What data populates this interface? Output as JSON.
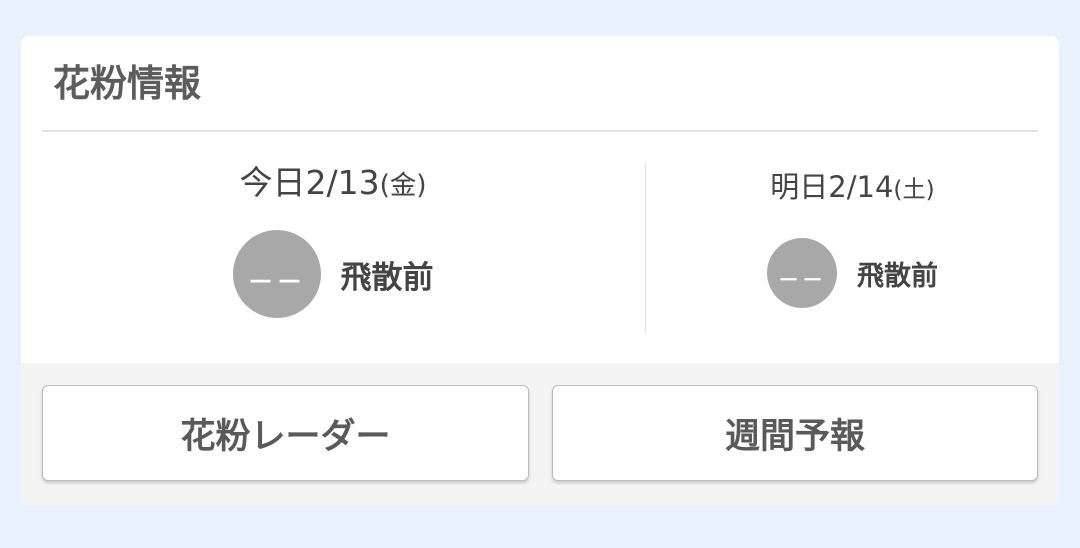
{
  "card": {
    "title": "花粉情報"
  },
  "today": {
    "prefix": "今日",
    "date": "2/13",
    "weekday": "(金)",
    "level_value": "－－",
    "level_label": "飛散前"
  },
  "tomorrow": {
    "prefix": "明日",
    "date": "2/14",
    "weekday": "(土)",
    "level_value": "－－",
    "level_label": "飛散前"
  },
  "buttons": {
    "radar_label": "花粉レーダー",
    "weekly_label": "週間予報"
  },
  "colors": {
    "page_background": "#e8f1fc",
    "card_background": "#ffffff",
    "level_circle": "#a8a8a8",
    "button_area_background": "#f4f4f4"
  }
}
